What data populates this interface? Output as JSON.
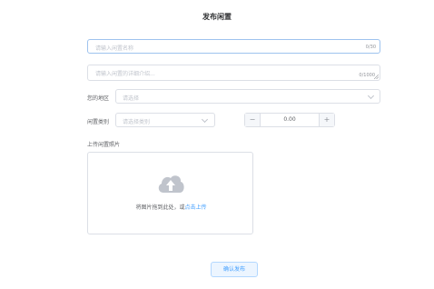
{
  "page": {
    "title": "发布闲置"
  },
  "form": {
    "name": {
      "placeholder": "请输入闲置名称",
      "counter": "0/30"
    },
    "description": {
      "placeholder": "请输入闲置的详细介绍...",
      "counter": "0/1000"
    },
    "region": {
      "label": "您的地区",
      "placeholder": "请选择"
    },
    "category": {
      "label": "闲置类别",
      "placeholder": "请选择类别"
    },
    "price": {
      "value": "0.00",
      "minus": "−",
      "plus": "+"
    },
    "upload": {
      "label": "上传闲置照片",
      "hint": "将图片拖到此处，或",
      "link": "点击上传"
    },
    "submit_label": "确认发布"
  },
  "colors": {
    "accent": "#409eff",
    "border": "#dcdfe6",
    "focus_border": "#9ec3ee",
    "placeholder": "#c0c4cc"
  },
  "icons": {
    "upload": "cloud-upload-icon",
    "select": "chevron-down-icon"
  }
}
